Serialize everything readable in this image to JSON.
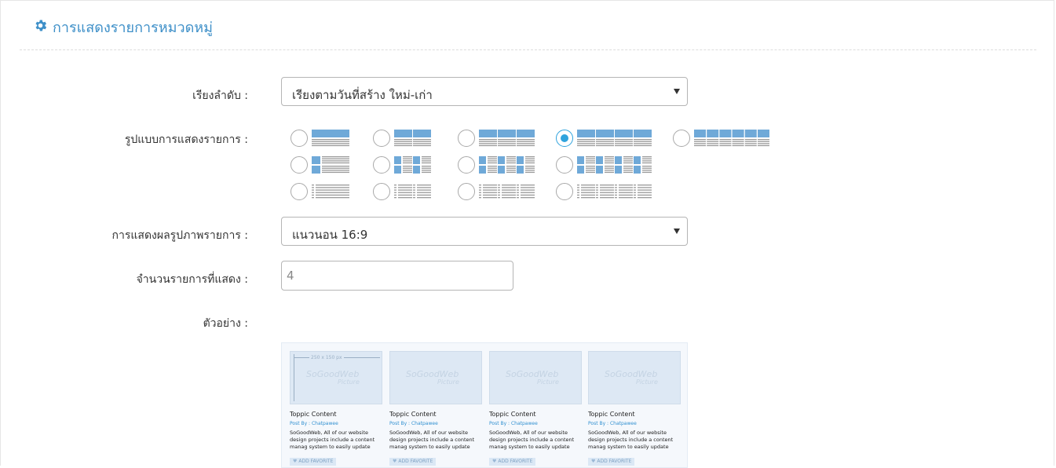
{
  "header": {
    "title": "การแสดงรายการหมวดหมู่",
    "icon": "gear-icon"
  },
  "sort": {
    "label": "เรียงลำดับ :",
    "value": "เรียงตามวันที่สร้าง ใหม่-เก่า"
  },
  "layout": {
    "label": "รูปแบบการแสดงรายการ :",
    "selected_index": 3,
    "accent": "#2fa3dd",
    "icon_color": "#6fa9d8"
  },
  "image_display": {
    "label": "การแสดงผลรูปภาพรายการ :",
    "value": "แนวนอน 16:9"
  },
  "count": {
    "label": "จำนวนรายการที่แสดง :",
    "value": "4"
  },
  "preview": {
    "label": "ตัวอย่าง :",
    "cards": [
      {
        "dimension": "250 x 150 px",
        "watermark": "SoGoodWeb",
        "watermark_sub": "Picture",
        "title": "Toppic Content",
        "post": "Post By : Chatpawee",
        "desc": "SoGoodWeb, All of our website design projects include a content manag system to easily update your",
        "fav": "ADD FAVORITE"
      },
      {
        "dimension": "",
        "watermark": "SoGoodWeb",
        "watermark_sub": "Picture",
        "title": "Toppic Content",
        "post": "Post By : Chatpawee",
        "desc": "SoGoodWeb, All of our website design projects include a content manag system to easily update your",
        "fav": "ADD FAVORITE"
      },
      {
        "dimension": "",
        "watermark": "SoGoodWeb",
        "watermark_sub": "Picture",
        "title": "Toppic Content",
        "post": "Post By : Chatpawee",
        "desc": "SoGoodWeb, All of our website design projects include a content manag system to easily update your",
        "fav": "ADD FAVORITE"
      },
      {
        "dimension": "",
        "watermark": "SoGoodWeb",
        "watermark_sub": "Picture",
        "title": "Toppic Content",
        "post": "Post By : Chatpawee",
        "desc": "SoGoodWeb, All of our website design projects include a content manag system to easily update your",
        "fav": "ADD FAVORITE"
      }
    ]
  }
}
